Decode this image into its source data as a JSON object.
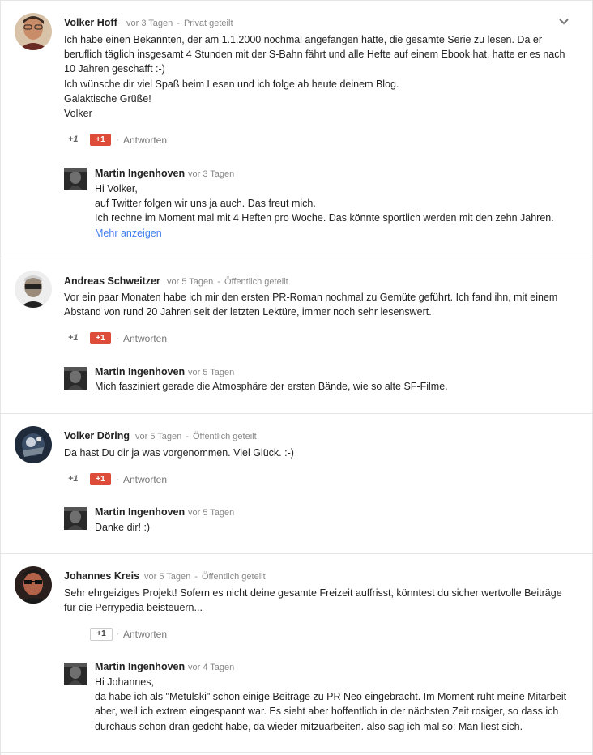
{
  "ui": {
    "plus_one_label": "+1",
    "reply_label": "Antworten",
    "more_label": "Mehr anzeigen",
    "separator": "-",
    "accent_color": "#dd4b39",
    "link_color": "#427fed"
  },
  "comments": [
    {
      "author": "Volker Hoff",
      "time": "vor 3 Tagen",
      "visibility": "Privat geteilt",
      "lines": [
        "Ich habe einen Bekannten, der am 1.1.2000 nochmal angefangen hatte, die gesamte Serie zu lesen. Da er beruflich täglich insgesamt 4 Stunden mit der S-Bahn fährt und alle Hefte auf einem Ebook hat, hatte er es nach 10 Jahren geschafft :-)",
        "Ich wünsche dir viel Spaß beim Lesen und ich folge ab heute deinem Blog.",
        "Galaktische Grüße!",
        "Volker"
      ],
      "reply": {
        "author": "Martin Ingenhoven",
        "time": "vor 3 Tagen",
        "lines": [
          "Hi Volker,",
          "auf Twitter folgen wir uns ja auch. Das freut mich.",
          "Ich rechne im Moment mal mit 4 Heften pro Woche. Das könnte sportlich werden mit den zehn Jahren."
        ]
      }
    },
    {
      "author": "Andreas Schweitzer",
      "time": "vor 5 Tagen",
      "visibility": "Öffentlich geteilt",
      "lines": [
        "Vor ein paar Monaten habe ich mir den ersten PR-Roman nochmal zu Gemüte geführt. Ich fand ihn, mit einem Abstand von rund 20 Jahren seit der letzten Lektüre, immer noch sehr lesenswert."
      ],
      "reply": {
        "author": "Martin Ingenhoven",
        "time": "vor 5 Tagen",
        "lines": [
          "Mich fasziniert gerade die Atmosphäre der ersten Bände, wie so alte SF-Filme."
        ]
      }
    },
    {
      "author": "Volker Döring",
      "time": "vor 5 Tagen",
      "visibility": "Öffentlich geteilt",
      "lines": [
        "Da hast Du dir ja was vorgenommen. Viel Glück. :-)"
      ],
      "reply": {
        "author": "Martin Ingenhoven",
        "time": "vor 5 Tagen",
        "lines": [
          "Danke dir! :)"
        ]
      }
    },
    {
      "author": "Johannes Kreis",
      "time": "vor 5 Tagen",
      "visibility": "Öffentlich geteilt",
      "lines": [
        "Sehr ehrgeiziges Projekt! Sofern es nicht deine gesamte Freizeit auffrisst, könntest du sicher wertvolle Beiträge für die Perrypedia beisteuern..."
      ],
      "reply": {
        "author": "Martin Ingenhoven",
        "time": "vor 4 Tagen",
        "lines": [
          "Hi Johannes,",
          "da habe ich als \"Metulski\" schon einige Beiträge zu PR Neo eingebracht. Im Moment ruht meine Mitarbeit aber, weil ich extrem eingespannt war. Es sieht aber hoffentlich in der nächsten Zeit rosiger, so dass ich durchaus schon dran gedcht habe, da wieder mitzuarbeiten. also sag ich mal so: Man liest sich."
        ]
      }
    }
  ]
}
